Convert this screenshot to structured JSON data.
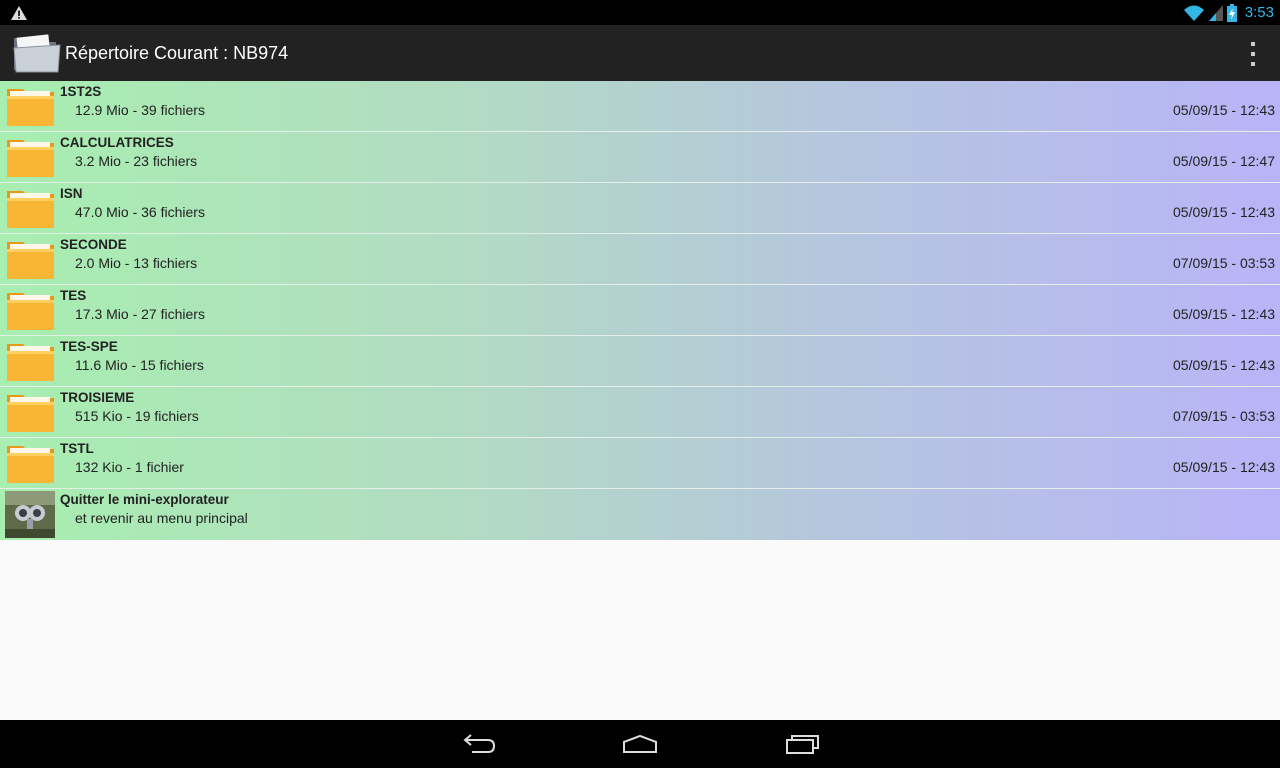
{
  "status_bar": {
    "time": "3:53",
    "icons": [
      "warning-icon",
      "wifi-icon",
      "signal-icon",
      "battery-icon"
    ],
    "accent_color": "#33b5e5"
  },
  "action_bar": {
    "title": "Répertoire Courant : NB974",
    "icon": "folder-icon",
    "menu_icon": "overflow-menu-icon"
  },
  "folders": [
    {
      "name": "1ST2S",
      "info": "12.9 Mio - 39 fichiers",
      "date": "05/09/15 - 12:43"
    },
    {
      "name": "CALCULATRICES",
      "info": "3.2 Mio - 23 fichiers",
      "date": "05/09/15 - 12:47"
    },
    {
      "name": "ISN",
      "info": "47.0 Mio - 36 fichiers",
      "date": "05/09/15 - 12:43"
    },
    {
      "name": "SECONDE",
      "info": "2.0 Mio - 13 fichiers",
      "date": "07/09/15 - 03:53"
    },
    {
      "name": "TES",
      "info": "17.3 Mio - 27 fichiers",
      "date": "05/09/15 - 12:43"
    },
    {
      "name": "TES-SPE",
      "info": "11.6 Mio - 15 fichiers",
      "date": "05/09/15 - 12:43"
    },
    {
      "name": "TROISIEME",
      "info": "515 Kio - 19 fichiers",
      "date": "07/09/15 - 03:53"
    },
    {
      "name": "TSTL",
      "info": "132 Kio - 1 fichier",
      "date": "05/09/15 - 12:43"
    }
  ],
  "exit_item": {
    "title": "Quitter le mini-explorateur",
    "subtitle": "et revenir au menu principal"
  },
  "nav_bar": {
    "buttons": [
      "back-icon",
      "home-icon",
      "recent-apps-icon"
    ]
  }
}
